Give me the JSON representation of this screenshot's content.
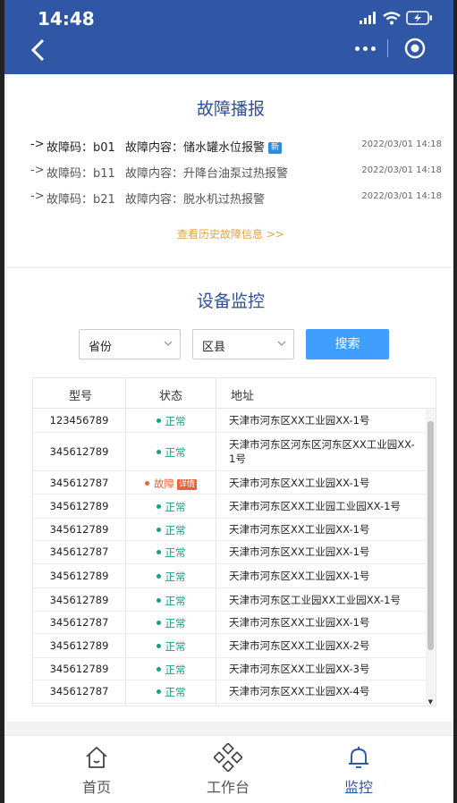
{
  "status_bar": {
    "time": "14:48"
  },
  "fault_section": {
    "title": "故障播报",
    "items": [
      {
        "arrow": "->",
        "code": "故障码：b01",
        "content": "故障内容：储水罐水位报警",
        "badge": "新",
        "time": "2022/03/01 14:18"
      },
      {
        "arrow": "->",
        "code": "故障码：b11",
        "content": "故障内容：升降台油泵过热报警",
        "time": "2022/03/01 14:18"
      },
      {
        "arrow": "->",
        "code": "故障码：b21",
        "content": "故障内容：脱水机过热报警",
        "time": "2022/03/01 14:18"
      }
    ],
    "history_link": "查看历史故障信息 >>"
  },
  "monitor_section": {
    "title": "设备监控",
    "filters": {
      "province": "省份",
      "district": "区县",
      "search": "搜索"
    },
    "table": {
      "headers": [
        "型号",
        "状态",
        "地址"
      ],
      "rows": [
        {
          "model": "123456789",
          "status": "正常",
          "address": "天津市河东区XX工业园XX-1号"
        },
        {
          "model": "345612789",
          "status": "正常",
          "address": "天津市河东区河东区河东区XX工业园XX-1号"
        },
        {
          "model": "345612787",
          "status": "故障",
          "detail": "详情",
          "address": "天津市河东区XX工业园XX-1号"
        },
        {
          "model": "345612789",
          "status": "正常",
          "address": "天津市河东区XX工业园工业园XX-1号"
        },
        {
          "model": "345612789",
          "status": "正常",
          "address": "天津市河东区XX工业园XX-1号"
        },
        {
          "model": "345612787",
          "status": "正常",
          "address": "天津市河东区XX工业园XX-1号"
        },
        {
          "model": "345612789",
          "status": "正常",
          "address": "天津市河东区XX工业园XX-1号"
        },
        {
          "model": "345612789",
          "status": "正常",
          "address": "天津市河东区工业园XX工业园XX-1号"
        },
        {
          "model": "345612787",
          "status": "正常",
          "address": "天津市河东区XX工业园XX-1号"
        },
        {
          "model": "345612789",
          "status": "正常",
          "address": "天津市河东区XX工业园XX-2号"
        },
        {
          "model": "345612789",
          "status": "正常",
          "address": "天津市河东区XX工业园XX-3号"
        },
        {
          "model": "345612787",
          "status": "正常",
          "address": "天津市河东区XX工业园XX-4号"
        }
      ]
    }
  },
  "tab_bar": {
    "tabs": [
      {
        "label": "首页",
        "icon": "home-icon"
      },
      {
        "label": "工作台",
        "icon": "workbench-icon"
      },
      {
        "label": "监控",
        "icon": "bell-icon",
        "active": true
      }
    ]
  },
  "colors": {
    "header": "#2f57a6",
    "accent": "#409eff",
    "ok": "#16a085",
    "fault": "#e8643a",
    "link": "#e6a23c"
  }
}
